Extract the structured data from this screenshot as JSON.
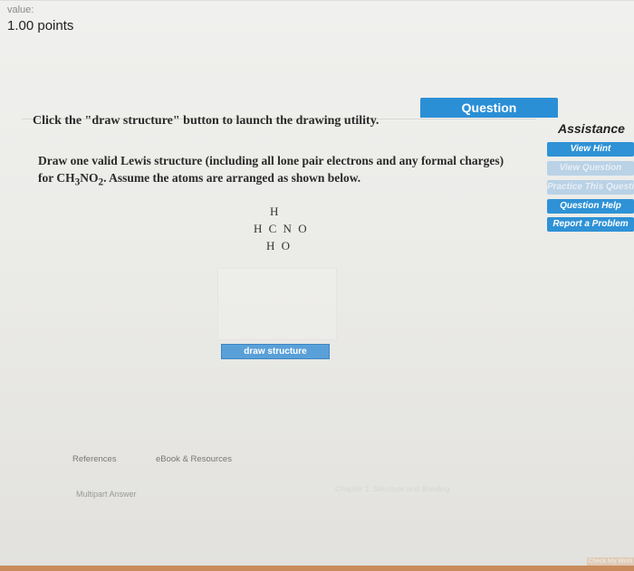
{
  "header": {
    "value_label": "value:",
    "points": "1.00 points"
  },
  "question": {
    "tab_label": "Question",
    "instruction": "Click the \"draw structure\" button to launch the drawing utility.",
    "prompt_line1": "Draw one valid Lewis structure (including all lone pair electrons and any formal charges)",
    "prompt_line2_pre": "for CH",
    "sub_3": "3",
    "prompt_line2_mid": "NO",
    "sub_2": "2",
    "prompt_line2_post": ". Assume the atoms are arranged as shown below.",
    "atoms_row1": "H",
    "atoms_row2": "H C N O",
    "atoms_row3": "H O",
    "draw_button": "draw structure"
  },
  "assistance": {
    "title": "Assistance",
    "buttons": [
      {
        "label": "View Hint",
        "enabled": true
      },
      {
        "label": "View Question",
        "enabled": false
      },
      {
        "label": "Practice This Question",
        "enabled": false
      },
      {
        "label": "Question Help",
        "enabled": true
      },
      {
        "label": "Report a Problem",
        "enabled": true
      }
    ]
  },
  "footer": {
    "references": "References",
    "ebook": "eBook & Resources",
    "multipart": "Multipart Answer",
    "crumb": "Chapter 1: Structure and Bonding",
    "corner": "Check My Work"
  },
  "colors": {
    "accent": "#2b8fd6",
    "bottom_bar": "#c98b5c"
  }
}
